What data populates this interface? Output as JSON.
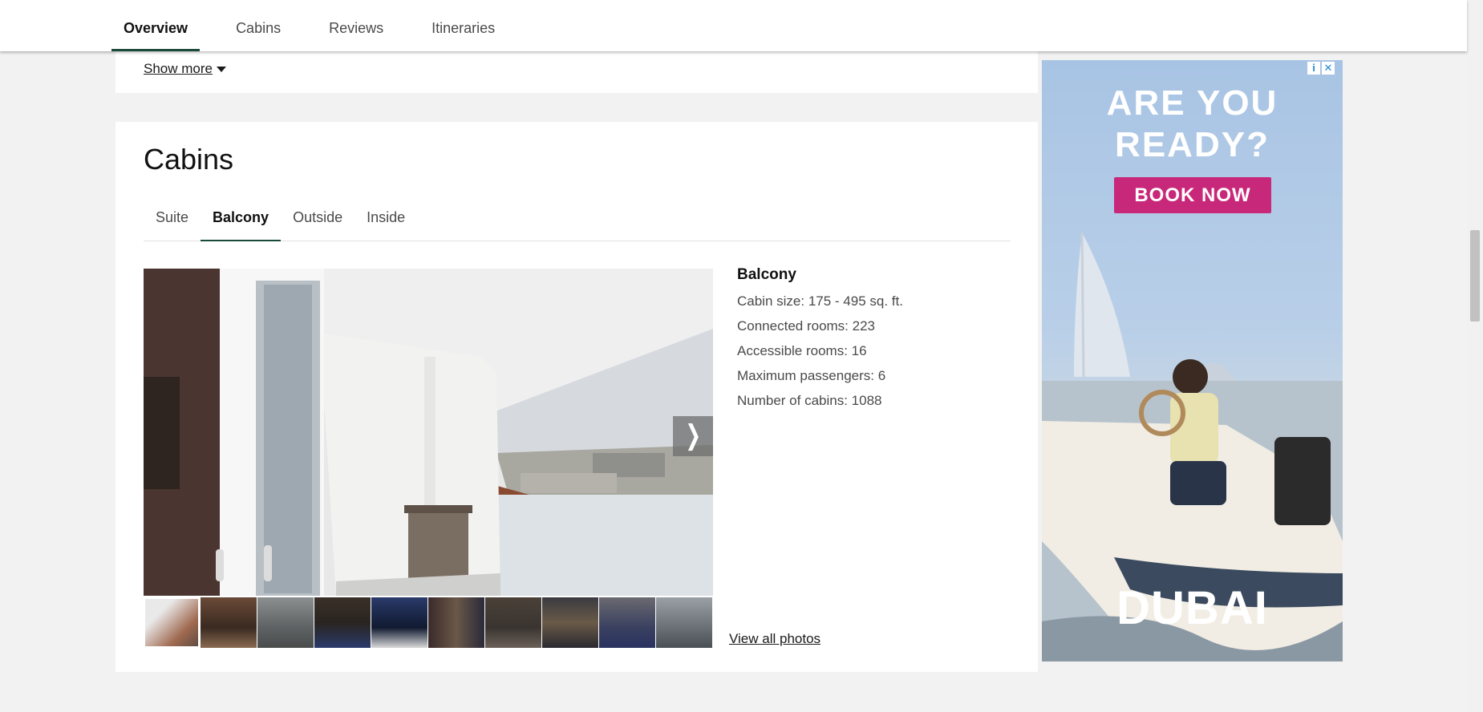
{
  "topnav": {
    "tabs": [
      {
        "label": "Overview",
        "active": true
      },
      {
        "label": "Cabins",
        "active": false
      },
      {
        "label": "Reviews",
        "active": false
      },
      {
        "label": "Itineraries",
        "active": false
      }
    ]
  },
  "overview": {
    "show_more_label": "Show more"
  },
  "cabins": {
    "title": "Cabins",
    "tabs": [
      {
        "label": "Suite",
        "active": false
      },
      {
        "label": "Balcony",
        "active": true
      },
      {
        "label": "Outside",
        "active": false
      },
      {
        "label": "Inside",
        "active": false
      }
    ],
    "details": {
      "heading": "Balcony",
      "cabin_size": "Cabin size: 175 - 495 sq. ft.",
      "connected_rooms": "Connected rooms: 223",
      "accessible_rooms": "Accessible rooms: 16",
      "max_passengers": "Maximum passengers: 6",
      "num_cabins": "Number of cabins: 1088"
    },
    "view_all_label": "View all photos",
    "next_icon": "chevron-right-icon"
  },
  "ad": {
    "headline_line1": "ARE YOU",
    "headline_line2": "READY?",
    "cta": "BOOK NOW",
    "brand": "DUBAI",
    "info_icon": "info-icon",
    "close_icon": "close-icon"
  },
  "colors": {
    "accent": "#1a4a3a",
    "ad_cta": "#c8287a",
    "background": "#f2f2f2"
  }
}
